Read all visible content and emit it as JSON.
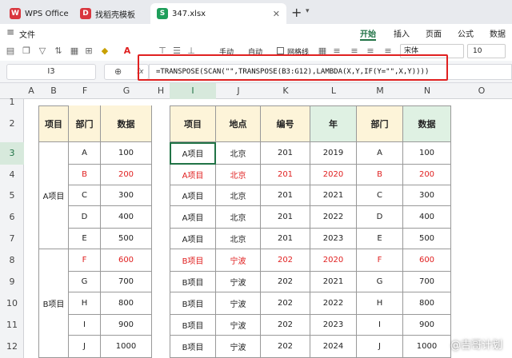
{
  "tabs": [
    {
      "label": "WPS Office",
      "icon": "wps-logo-icon",
      "icon_text": "W",
      "color": "#d9363e"
    },
    {
      "label": "找稻壳模板",
      "icon": "docer-logo-icon",
      "icon_text": "D",
      "color": "#d9363e"
    },
    {
      "label": "347.xlsx",
      "icon": "spreadsheet-icon",
      "icon_text": "S",
      "color": "#1e9e5a"
    }
  ],
  "menu": {
    "file": "文件",
    "ribbon_tabs": [
      "开始",
      "插入",
      "页面",
      "公式",
      "数据"
    ],
    "active_tab": "开始"
  },
  "toolbar": {
    "manual": "手动",
    "auto": "自动",
    "gridlines": "网格线",
    "font": "宋体",
    "font_size": "10"
  },
  "name_box": "I3",
  "fx_label": "fx",
  "formula": "=TRANSPOSE(SCAN(\"\",TRANSPOSE(B3:G12),LAMBDA(X,Y,IF(Y=\"\",X,Y))))",
  "columns": [
    "A",
    "B",
    "F",
    "G",
    "H",
    "I",
    "J",
    "K",
    "L",
    "M",
    "N",
    "O"
  ],
  "rows": [
    "1",
    "2",
    "3",
    "4",
    "5",
    "6",
    "7",
    "8",
    "9",
    "10",
    "11",
    "12"
  ],
  "left_table": {
    "headers": [
      "项目",
      "部门",
      "数据"
    ],
    "groups": [
      {
        "project": "A项目",
        "rows": [
          [
            "A",
            "100",
            false
          ],
          [
            "B",
            "200",
            true
          ],
          [
            "C",
            "300",
            false
          ],
          [
            "D",
            "400",
            false
          ],
          [
            "E",
            "500",
            false
          ]
        ]
      },
      {
        "project": "B项目",
        "rows": [
          [
            "F",
            "600",
            true
          ],
          [
            "G",
            "700",
            false
          ],
          [
            "H",
            "800",
            false
          ],
          [
            "I",
            "900",
            false
          ],
          [
            "J",
            "1000",
            false
          ]
        ]
      }
    ]
  },
  "right_table": {
    "headers": [
      "项目",
      "地点",
      "编号",
      "年",
      "部门",
      "数据"
    ],
    "rows": [
      [
        "A项目",
        "北京",
        "201",
        "2019",
        "A",
        "100",
        false
      ],
      [
        "A项目",
        "北京",
        "201",
        "2020",
        "B",
        "200",
        true
      ],
      [
        "A项目",
        "北京",
        "201",
        "2021",
        "C",
        "300",
        false
      ],
      [
        "A项目",
        "北京",
        "201",
        "2022",
        "D",
        "400",
        false
      ],
      [
        "A项目",
        "北京",
        "201",
        "2023",
        "E",
        "500",
        false
      ],
      [
        "B项目",
        "宁波",
        "202",
        "2020",
        "F",
        "600",
        true
      ],
      [
        "B项目",
        "宁波",
        "202",
        "2021",
        "G",
        "700",
        false
      ],
      [
        "B项目",
        "宁波",
        "202",
        "2022",
        "H",
        "800",
        false
      ],
      [
        "B项目",
        "宁波",
        "202",
        "2023",
        "I",
        "900",
        false
      ],
      [
        "B项目",
        "宁波",
        "202",
        "2024",
        "J",
        "1000",
        false
      ]
    ]
  },
  "watermark": "@吉哥计划",
  "colors": {
    "accent": "#217346",
    "highlight_red": "#e02020",
    "header_yellow": "#fdf4d9",
    "header_green": "#dff1e3"
  }
}
